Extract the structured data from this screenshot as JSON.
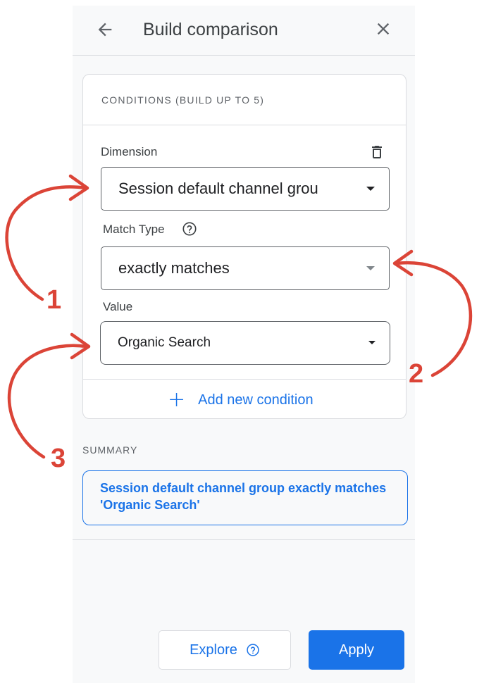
{
  "header": {
    "title": "Build comparison"
  },
  "conditions": {
    "heading": "CONDITIONS (BUILD UP TO 5)",
    "dimension_label": "Dimension",
    "dimension_value": "Session default channel grou",
    "match_type_label": "Match Type",
    "match_type_value": "exactly matches",
    "value_label": "Value",
    "value_value": "Organic Search",
    "add_condition": "Add new condition"
  },
  "summary": {
    "label": "SUMMARY",
    "text": "Session default channel group exactly matches 'Organic Search'"
  },
  "footer": {
    "explore_label": "Explore",
    "apply_label": "Apply"
  },
  "annotations": {
    "one": "1",
    "two": "2",
    "three": "3"
  },
  "colors": {
    "accent": "#1a73e8",
    "annotation": "#db4437",
    "panel_bg": "#f8f9fa",
    "border": "#dadce0"
  }
}
